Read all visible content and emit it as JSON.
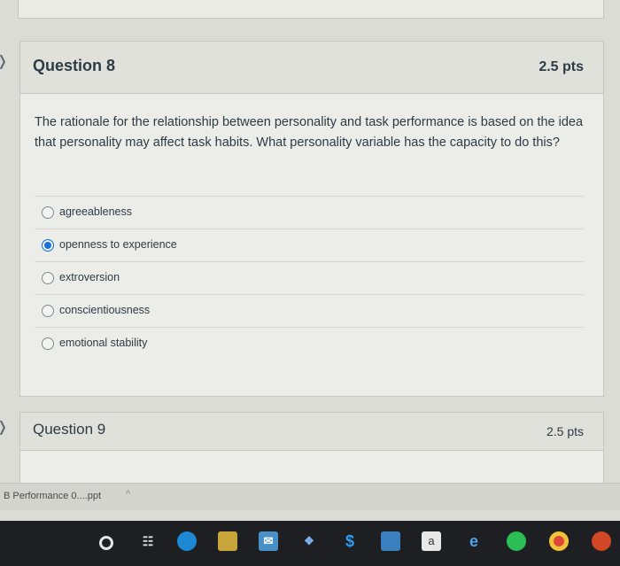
{
  "question8": {
    "title": "Question 8",
    "points": "2.5 pts",
    "text": "The rationale for the relationship between personality and task performance is based on the idea that personality may affect task habits. What personality variable has the capacity to do this?",
    "answers": [
      {
        "label": "agreeableness",
        "selected": false
      },
      {
        "label": "openness to experience",
        "selected": true
      },
      {
        "label": "extroversion",
        "selected": false
      },
      {
        "label": "conscientiousness",
        "selected": false
      },
      {
        "label": "emotional stability",
        "selected": false
      }
    ]
  },
  "question9": {
    "title": "Question 9",
    "points": "2.5 pts"
  },
  "download_bar": {
    "file_name": "B Performance 0....ppt",
    "caret": "^"
  },
  "taskbar": {
    "icons": [
      "cortana-icon",
      "task-view-icon",
      "edge-icon",
      "store-icon",
      "mail-icon",
      "dropbox-icon",
      "money-icon",
      "photos-icon",
      "amazon-icon",
      "ie-icon",
      "spotify-icon",
      "chrome-icon",
      "powerpoint-icon"
    ],
    "amazon_label": "a"
  },
  "colors": {
    "accent_radio": "#1a73d6",
    "text": "#2d3b45",
    "taskbar": "#1d1f22"
  }
}
